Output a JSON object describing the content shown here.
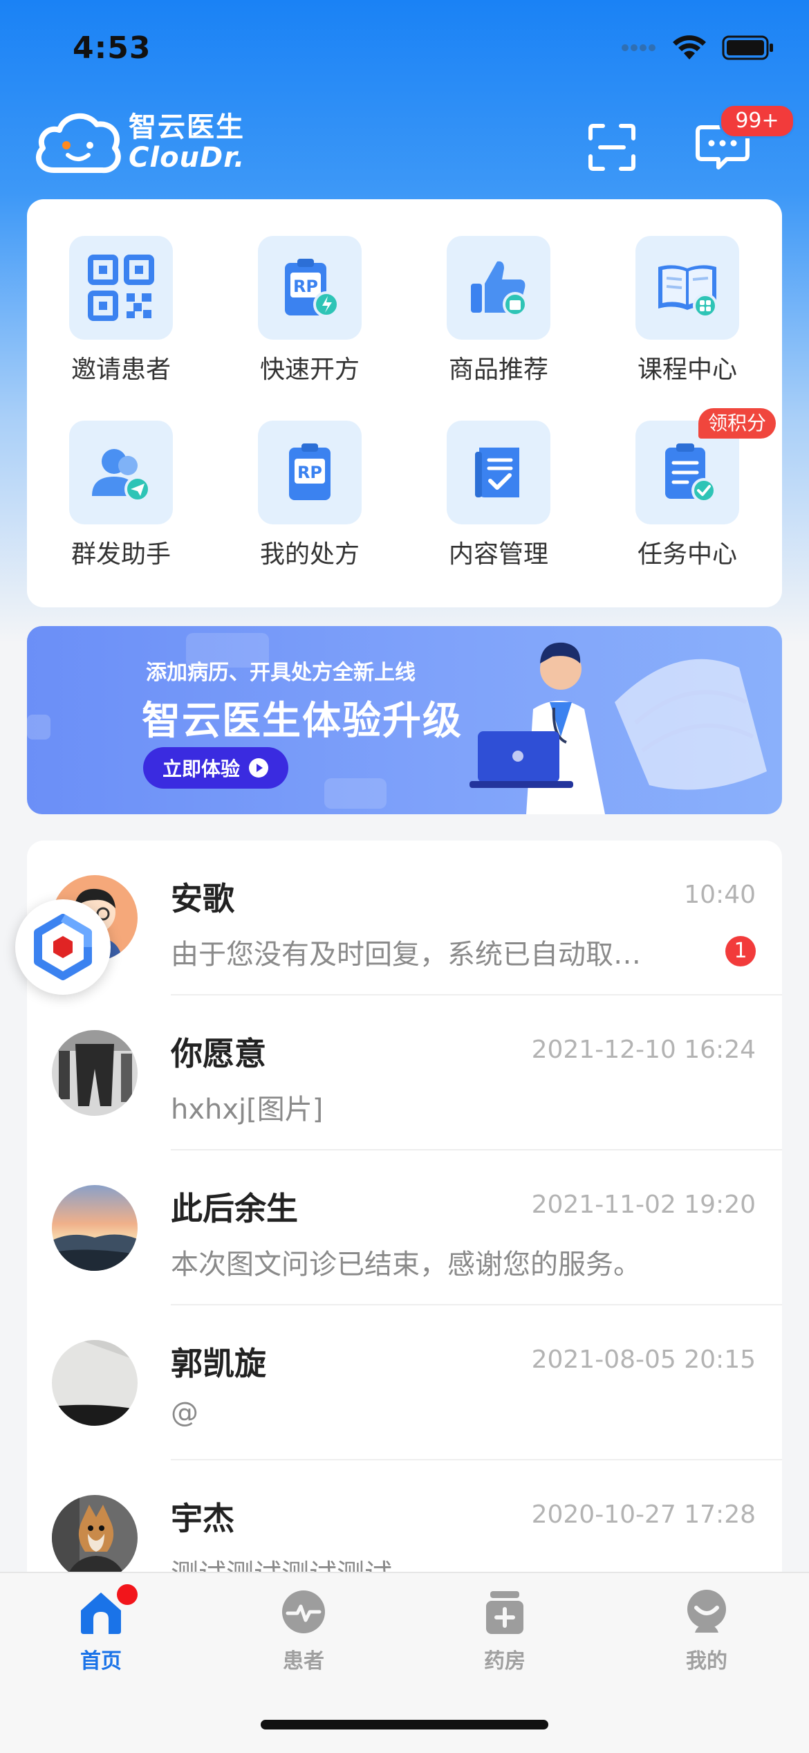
{
  "status_bar": {
    "time": "4:53"
  },
  "header": {
    "logo_cn": "智云医生",
    "logo_en": "ClouDr.",
    "message_badge": "99+"
  },
  "quick_actions": [
    {
      "label": "邀请患者",
      "icon": "qr-code-icon"
    },
    {
      "label": "快速开方",
      "icon": "quick-prescription-icon"
    },
    {
      "label": "商品推荐",
      "icon": "thumbs-up-icon"
    },
    {
      "label": "课程中心",
      "icon": "course-book-icon"
    },
    {
      "label": "群发助手",
      "icon": "group-send-icon"
    },
    {
      "label": "我的处方",
      "icon": "prescription-icon"
    },
    {
      "label": "内容管理",
      "icon": "content-manage-icon"
    },
    {
      "label": "任务中心",
      "icon": "task-center-icon"
    }
  ],
  "task_badge": "领积分",
  "banner": {
    "subtitle": "添加病历、开具处方全新上线",
    "title": "智云医生体验升级",
    "button": "立即体验"
  },
  "chats": [
    {
      "name": "安歌",
      "time": "10:40",
      "message": "由于您没有及时回复，系统已自动取…",
      "unread": "1"
    },
    {
      "name": "你愿意",
      "time": "2021-12-10 16:24",
      "message": "hxhxj[图片]"
    },
    {
      "name": "此后余生",
      "time": "2021-11-02 19:20",
      "message": "本次图文问诊已结束，感谢您的服务。"
    },
    {
      "name": "郭凯旋",
      "time": "2021-08-05 20:15",
      "message": "@"
    },
    {
      "name": "宇杰",
      "time": "2020-10-27 17:28",
      "message": "测试测试测试测试"
    }
  ],
  "tabs": [
    {
      "label": "首页",
      "icon": "home-icon",
      "active": true
    },
    {
      "label": "患者",
      "icon": "patient-icon"
    },
    {
      "label": "药房",
      "icon": "pharmacy-icon"
    },
    {
      "label": "我的",
      "icon": "profile-icon"
    }
  ],
  "colors": {
    "brand_blue": "#1a82f5",
    "badge_red": "#f23b3b",
    "tab_active": "#1a73e8",
    "banner_button": "#3a2be0"
  }
}
